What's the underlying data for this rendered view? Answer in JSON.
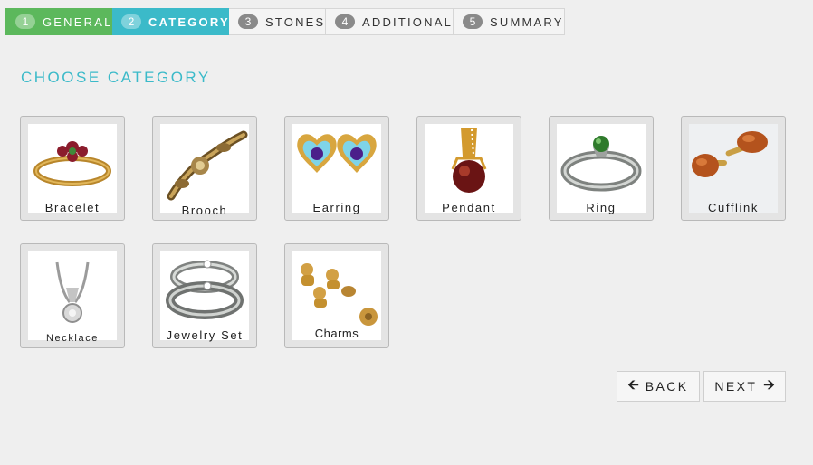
{
  "steps": [
    {
      "num": "1",
      "label": "General",
      "state": "done"
    },
    {
      "num": "2",
      "label": "Category",
      "state": "active"
    },
    {
      "num": "3",
      "label": "Stones",
      "state": "pending"
    },
    {
      "num": "4",
      "label": "Additional",
      "state": "pending"
    },
    {
      "num": "5",
      "label": "Summary",
      "state": "pending"
    }
  ],
  "heading": "CHOOSE CATEGORY",
  "categories": [
    {
      "label": "Bracelet",
      "icon": "bracelet-icon"
    },
    {
      "label": "Brooch",
      "icon": "brooch-icon"
    },
    {
      "label": "Earring",
      "icon": "earring-icon"
    },
    {
      "label": "Pendant",
      "icon": "pendant-icon"
    },
    {
      "label": "Ring",
      "icon": "ring-icon"
    },
    {
      "label": "Cufflink",
      "icon": "cufflink-icon"
    },
    {
      "label": "Necklace",
      "icon": "necklace-icon"
    },
    {
      "label": "Jewelry Set",
      "icon": "jewelry-set-icon"
    },
    {
      "label": "Charms",
      "icon": "charms-icon"
    }
  ],
  "nav": {
    "back_label": "BACK",
    "next_label": "NEXT",
    "back_icon": "arrow-left-icon",
    "next_icon": "arrow-right-icon"
  },
  "colors": {
    "done": "#5cb85c",
    "active": "#3bbac9",
    "heading": "#3bbac9"
  }
}
